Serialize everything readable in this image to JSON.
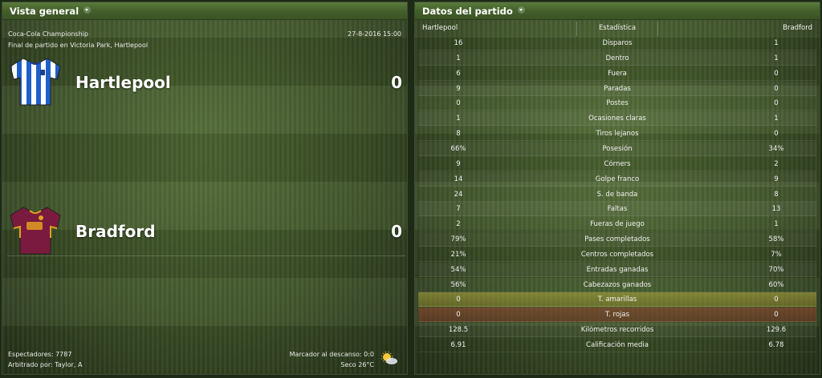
{
  "overview": {
    "title": "Vista general",
    "competition": "Coca-Cola Championship",
    "venue": "Final de partido en Victoria Park, Hartlepool",
    "datetime": "27-8-2016 15:00",
    "home": {
      "name": "Hartlepool",
      "score": "0",
      "shirt_colors": [
        "#1f5fc8",
        "#ffffff"
      ]
    },
    "away": {
      "name": "Bradford",
      "score": "0",
      "shirt_colors": [
        "#7a1a3e",
        "#e0a020"
      ]
    },
    "attendance": "Espectadores: 7787",
    "referee": "Arbitrado por: Taylor, A",
    "halftime": "Marcador al descanso: 0:0",
    "weather": "Seco 26°C",
    "weather_icon": "sun-cloud-icon"
  },
  "stats": {
    "title": "Datos del partido",
    "headers": {
      "home": "Hartlepool",
      "stat": "Estadística",
      "away": "Bradford"
    },
    "rows": [
      {
        "home": "16",
        "label": "Disparos",
        "away": "1"
      },
      {
        "home": "1",
        "label": "Dentro",
        "away": "1"
      },
      {
        "home": "6",
        "label": "Fuera",
        "away": "0"
      },
      {
        "home": "9",
        "label": "Paradas",
        "away": "0"
      },
      {
        "home": "0",
        "label": "Postes",
        "away": "0"
      },
      {
        "home": "1",
        "label": "Ocasiones claras",
        "away": "1"
      },
      {
        "home": "8",
        "label": "Tiros lejanos",
        "away": "0"
      },
      {
        "home": "66%",
        "label": "Posesión",
        "away": "34%"
      },
      {
        "home": "9",
        "label": "Córners",
        "away": "2"
      },
      {
        "home": "14",
        "label": "Golpe franco",
        "away": "9"
      },
      {
        "home": "24",
        "label": "S. de banda",
        "away": "8"
      },
      {
        "home": "7",
        "label": "Faltas",
        "away": "13"
      },
      {
        "home": "2",
        "label": "Fueras de juego",
        "away": "1"
      },
      {
        "home": "79%",
        "label": "Pases completados",
        "away": "58%"
      },
      {
        "home": "21%",
        "label": "Centros completados",
        "away": "7%"
      },
      {
        "home": "54%",
        "label": "Entradas ganadas",
        "away": "70%"
      },
      {
        "home": "56%",
        "label": "Cabezazos ganados",
        "away": "60%"
      },
      {
        "home": "0",
        "label": "T. amarillas",
        "away": "0",
        "highlight": "yellow"
      },
      {
        "home": "0",
        "label": "T. rojas",
        "away": "0",
        "highlight": "red"
      },
      {
        "home": "128.5",
        "label": "Kilómetros recorridos",
        "away": "129.6"
      },
      {
        "home": "6.91",
        "label": "Calificación media",
        "away": "6.78"
      }
    ]
  }
}
